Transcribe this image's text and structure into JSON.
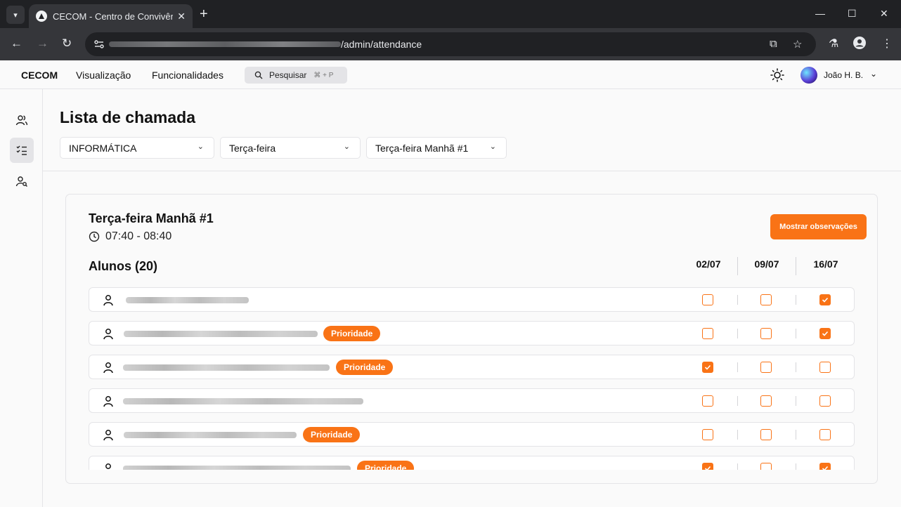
{
  "browser": {
    "tab_title": "CECOM - Centro de Convivência",
    "url_path": "/admin/attendance"
  },
  "app": {
    "brand": "CECOM",
    "nav": [
      "Visualização",
      "Funcionalidades"
    ],
    "search_label": "Pesquisar",
    "search_shortcut": "⌘ + P",
    "user_name": "João H. B."
  },
  "main": {
    "title": "Lista de chamada",
    "filters": {
      "course": "INFORMÁTICA",
      "day": "Terça-feira",
      "class": "Terça-feira Manhã #1"
    }
  },
  "card": {
    "class_title": "Terça-feira Manhã #1",
    "time": "07:40 - 08:40",
    "observations_button": "Mostrar observações",
    "students_title": "Alunos (20)",
    "dates": [
      "02/07",
      "09/07",
      "16/07"
    ],
    "priority_label": "Prioridade",
    "students": [
      {
        "priority": false,
        "attendance": [
          false,
          false,
          true
        ]
      },
      {
        "priority": true,
        "attendance": [
          false,
          false,
          true
        ]
      },
      {
        "priority": true,
        "attendance": [
          true,
          false,
          false
        ]
      },
      {
        "priority": false,
        "attendance": [
          false,
          false,
          false
        ]
      },
      {
        "priority": true,
        "attendance": [
          false,
          false,
          false
        ]
      },
      {
        "priority": true,
        "attendance": [
          true,
          false,
          true
        ]
      }
    ]
  },
  "colors": {
    "accent": "#f97316",
    "border": "#e4e4e7"
  }
}
